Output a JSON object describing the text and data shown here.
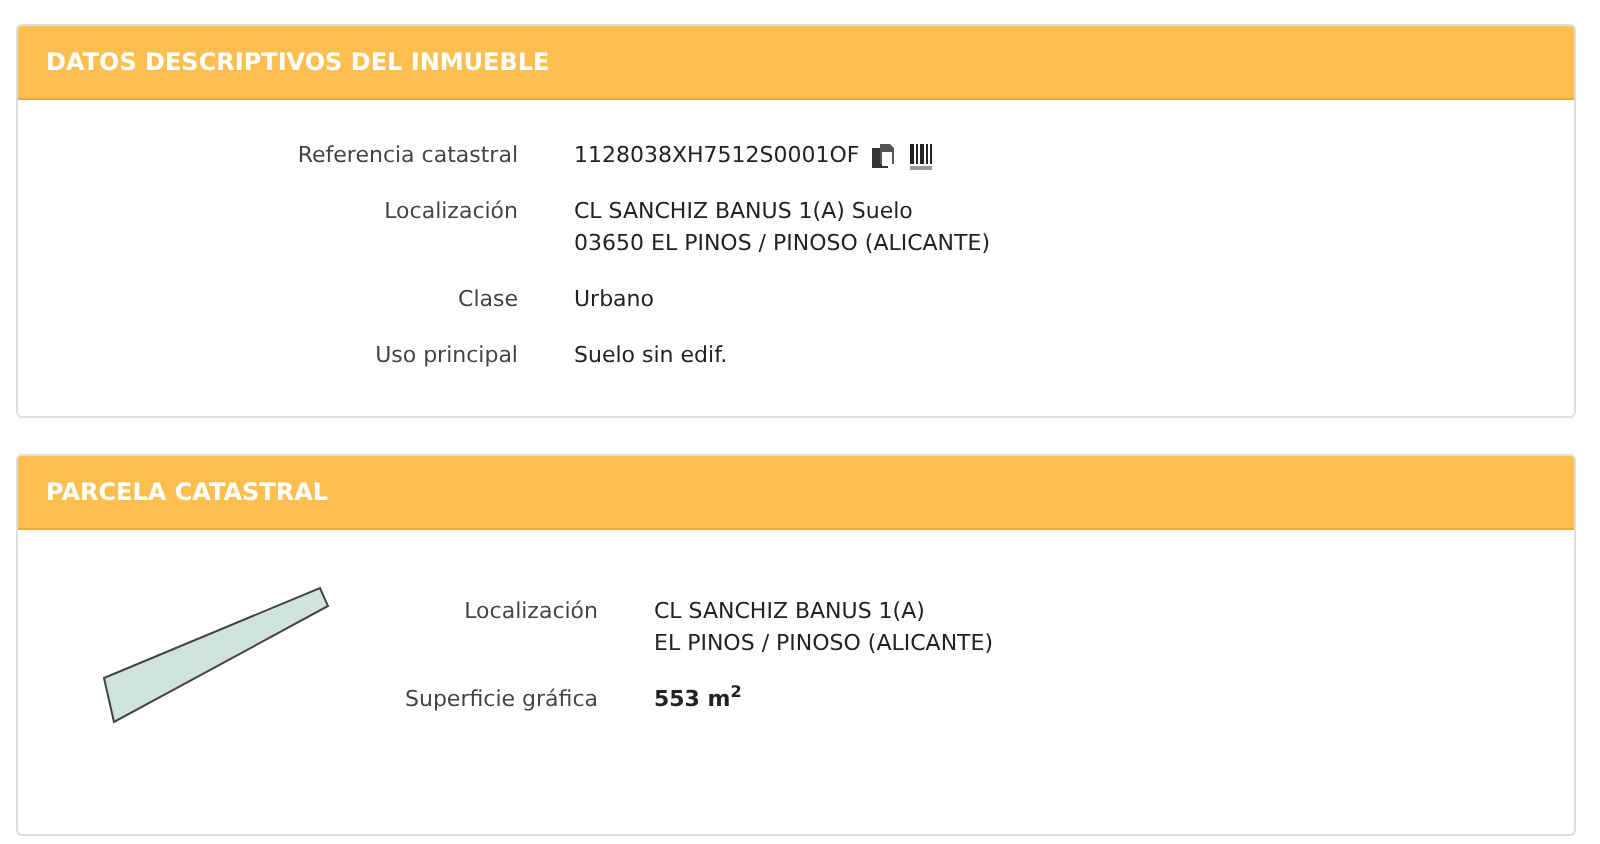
{
  "sections": [
    {
      "kind": "details",
      "title": "DATOS DESCRIPTIVOS DEL INMUEBLE",
      "rows": [
        {
          "label": "Referencia catastral",
          "lines": [
            "1128038XH7512S0001OF"
          ],
          "icons": true
        },
        {
          "label": "Localización",
          "lines": [
            "CL SANCHIZ BANUS 1(A) Suelo",
            "03650 EL PINOS / PINOSO (ALICANTE)"
          ]
        },
        {
          "label": "Clase",
          "lines": [
            "Urbano"
          ]
        },
        {
          "label": "Uso principal",
          "lines": [
            "Suelo sin edif."
          ]
        }
      ]
    },
    {
      "kind": "parcel",
      "title": "PARCELA CATASTRAL",
      "rows": [
        {
          "label": "Localización",
          "lines": [
            "CL SANCHIZ BANUS 1(A)",
            "EL PINOS / PINOSO (ALICANTE)"
          ]
        },
        {
          "label": "Superficie gráfica",
          "lines": [
            "553 m$^{2}$"
          ],
          "bold": true
        }
      ]
    }
  ]
}
